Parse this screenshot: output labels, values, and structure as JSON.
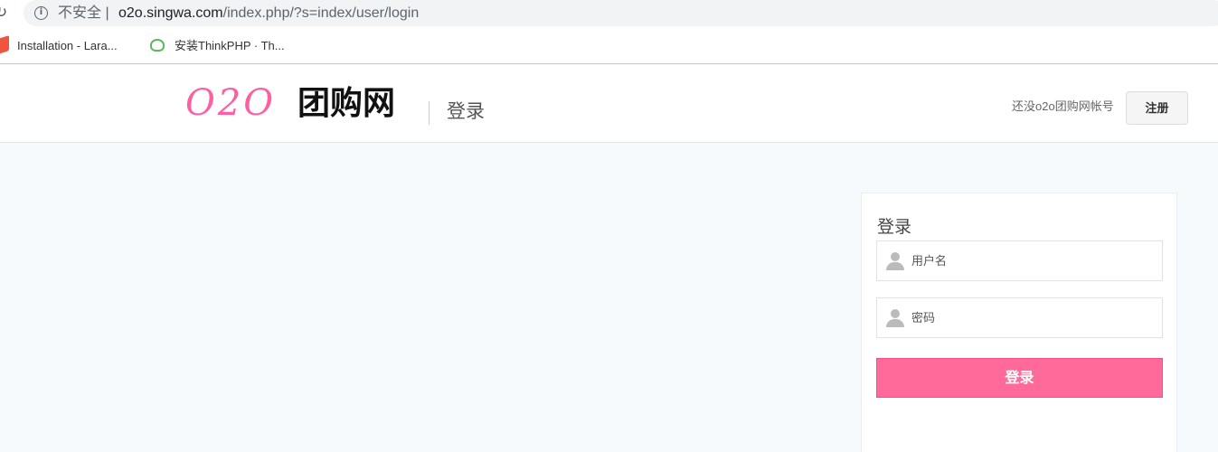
{
  "browser": {
    "insecure_label": "不安全",
    "url_host": "o2o.singwa.com",
    "url_path": "/index.php/?s=index/user/login"
  },
  "bookmarks": [
    {
      "label": "Installation - Lara..."
    },
    {
      "label": "安装ThinkPHP · Th..."
    }
  ],
  "header": {
    "logo_o2o": "O2O",
    "logo_name": "团购网",
    "subtitle": "登录",
    "no_account_text": "还没o2o团购网帐号",
    "register_label": "注册"
  },
  "login": {
    "title": "登录",
    "username_placeholder": "用户名",
    "password_placeholder": "密码",
    "submit_label": "登录"
  },
  "colors": {
    "brand_pink": "#ff6a9a",
    "logo_pink": "#ff5fa2"
  }
}
